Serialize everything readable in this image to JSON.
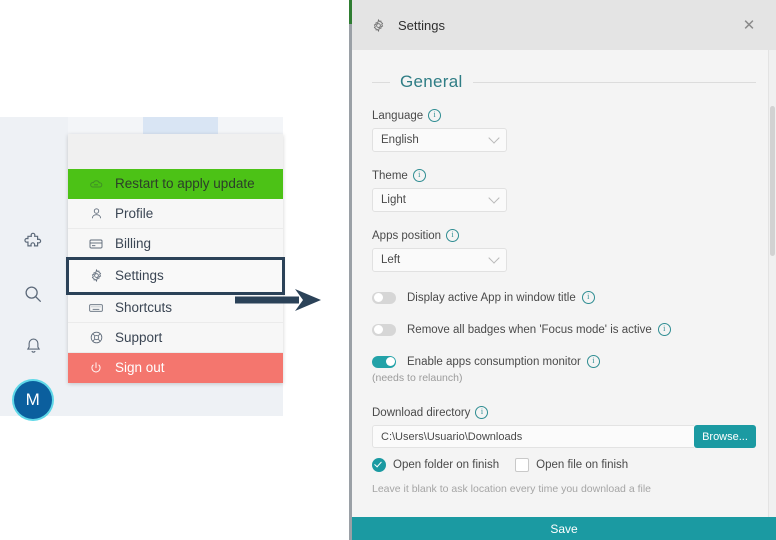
{
  "left_scene": {
    "rail": {
      "icons": [
        {
          "name": "puzzle-icon",
          "label": "Extensions"
        },
        {
          "name": "search-icon",
          "label": "Search"
        },
        {
          "name": "bell-icon",
          "label": "Notifications"
        }
      ],
      "avatar_initial": "M"
    },
    "user_menu": {
      "items": [
        {
          "label": "Restart to apply update",
          "icon": "cloud-icon",
          "style": "green"
        },
        {
          "label": "Profile",
          "icon": "person-icon",
          "style": "normal"
        },
        {
          "label": "Billing",
          "icon": "credit-card-icon",
          "style": "normal"
        },
        {
          "label": "Settings",
          "icon": "gear-icon",
          "style": "selected"
        },
        {
          "label": "Shortcuts",
          "icon": "keyboard-icon",
          "style": "normal"
        },
        {
          "label": "Support",
          "icon": "lifebuoy-icon",
          "style": "normal"
        },
        {
          "label": "Sign out",
          "icon": "power-icon",
          "style": "red"
        }
      ]
    },
    "annotation": {
      "arrow": "right-arrow",
      "highlight_target": "Settings"
    }
  },
  "settings_window": {
    "titlebar": {
      "icon": "gear-icon",
      "title": "Settings",
      "close_label": "✕"
    },
    "section": {
      "title": "General"
    },
    "fields": {
      "language": {
        "label": "Language",
        "value": "English",
        "info": "i"
      },
      "theme": {
        "label": "Theme",
        "value": "Light",
        "info": "i"
      },
      "apps_position": {
        "label": "Apps position",
        "value": "Left",
        "info": "i"
      }
    },
    "toggles": [
      {
        "label": "Display active App in window title",
        "state": "off",
        "info": "i",
        "note": ""
      },
      {
        "label": "Remove all badges when 'Focus mode' is active",
        "state": "off",
        "info": "i",
        "note": ""
      },
      {
        "label": "Enable apps consumption monitor",
        "state": "on",
        "info": "i",
        "note": "(needs to relaunch)"
      }
    ],
    "download": {
      "label": "Download directory",
      "info": "i",
      "path": "C:\\Users\\Usuario\\Downloads",
      "browse_label": "Browse...",
      "checkbox_folder": {
        "label": "Open folder on finish",
        "checked": true
      },
      "checkbox_file": {
        "label": "Open file on finish",
        "checked": false
      },
      "hint": "Leave it blank to ask location every time you download a file"
    },
    "footer": {
      "save_label": "Save"
    },
    "colors": {
      "accent_teal": "#1b9aa2",
      "section_heading": "#2f7d85",
      "menu_update_green": "#4cc216",
      "menu_signout_red": "#f4766e",
      "highlight_border_navy": "#2b4258",
      "avatar_blue": "#0b5f9e"
    }
  }
}
